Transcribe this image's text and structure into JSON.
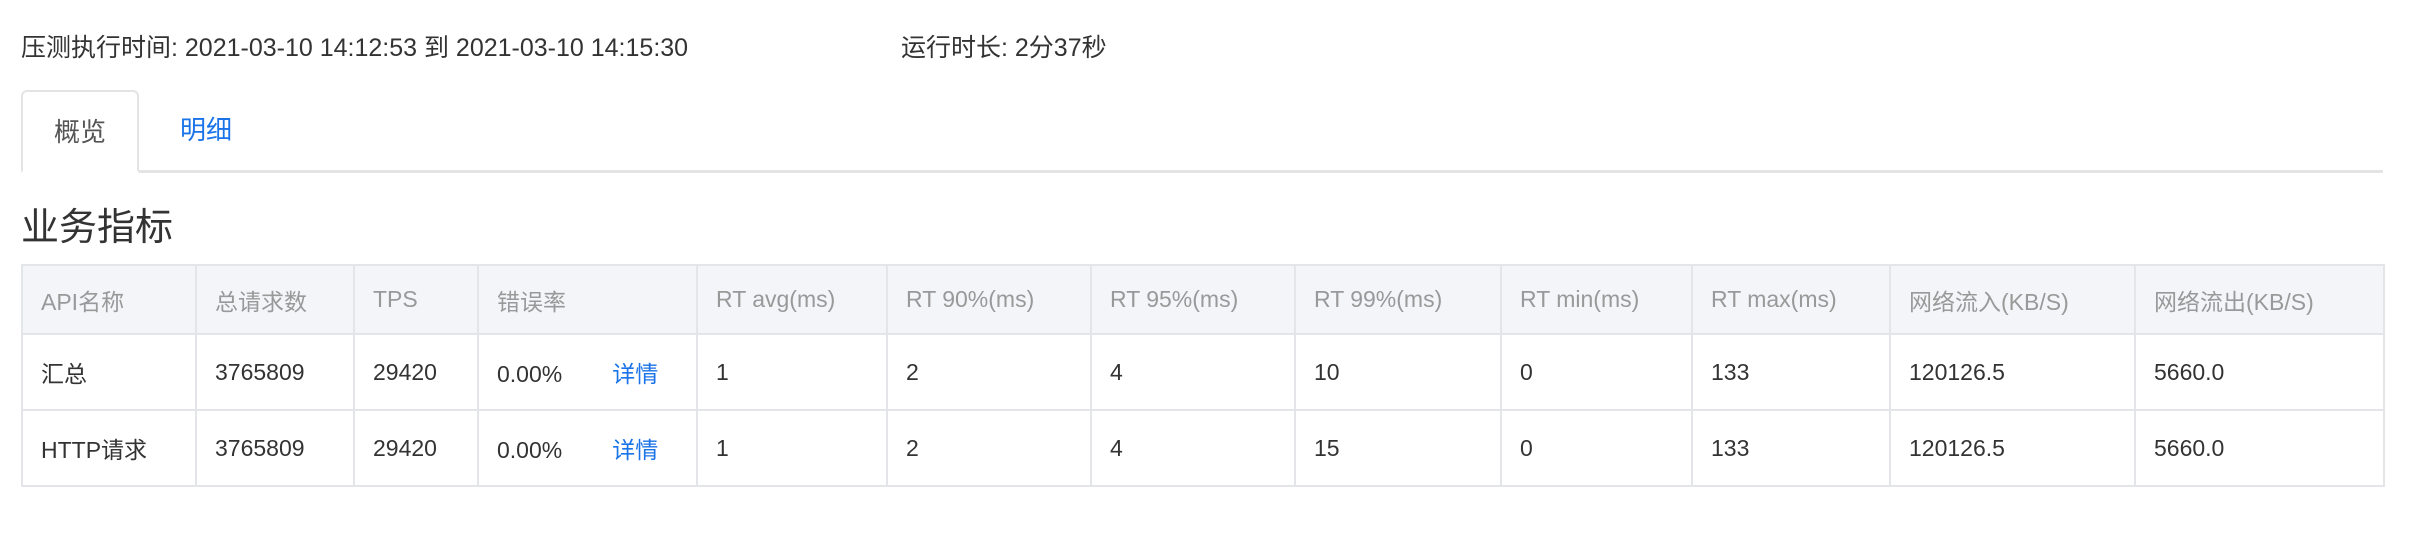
{
  "header": {
    "exec_time_label": "压测执行时间: 2021-03-10 14:12:53 到 2021-03-10 14:15:30",
    "duration_label": "运行时长: 2分37秒"
  },
  "tabs": [
    {
      "label": "概览",
      "active": true
    },
    {
      "label": "明细",
      "active": false
    }
  ],
  "section_title": "业务指标",
  "table": {
    "columns": [
      "API名称",
      "总请求数",
      "TPS",
      "错误率",
      "RT avg(ms)",
      "RT 90%(ms)",
      "RT 95%(ms)",
      "RT 99%(ms)",
      "RT min(ms)",
      "RT max(ms)",
      "网络流入(KB/S)",
      "网络流出(KB/S)"
    ],
    "detail_label": "详情",
    "rows": [
      [
        "汇总",
        "3765809",
        "29420",
        "0.00%",
        "1",
        "2",
        "4",
        "10",
        "0",
        "133",
        "120126.5",
        "5660.0"
      ],
      [
        "HTTP请求",
        "3765809",
        "29420",
        "0.00%",
        "1",
        "2",
        "4",
        "15",
        "0",
        "133",
        "120126.5",
        "5660.0"
      ]
    ]
  },
  "colors": {
    "link": "#1a73e8",
    "header_bg": "#f4f5f9"
  }
}
